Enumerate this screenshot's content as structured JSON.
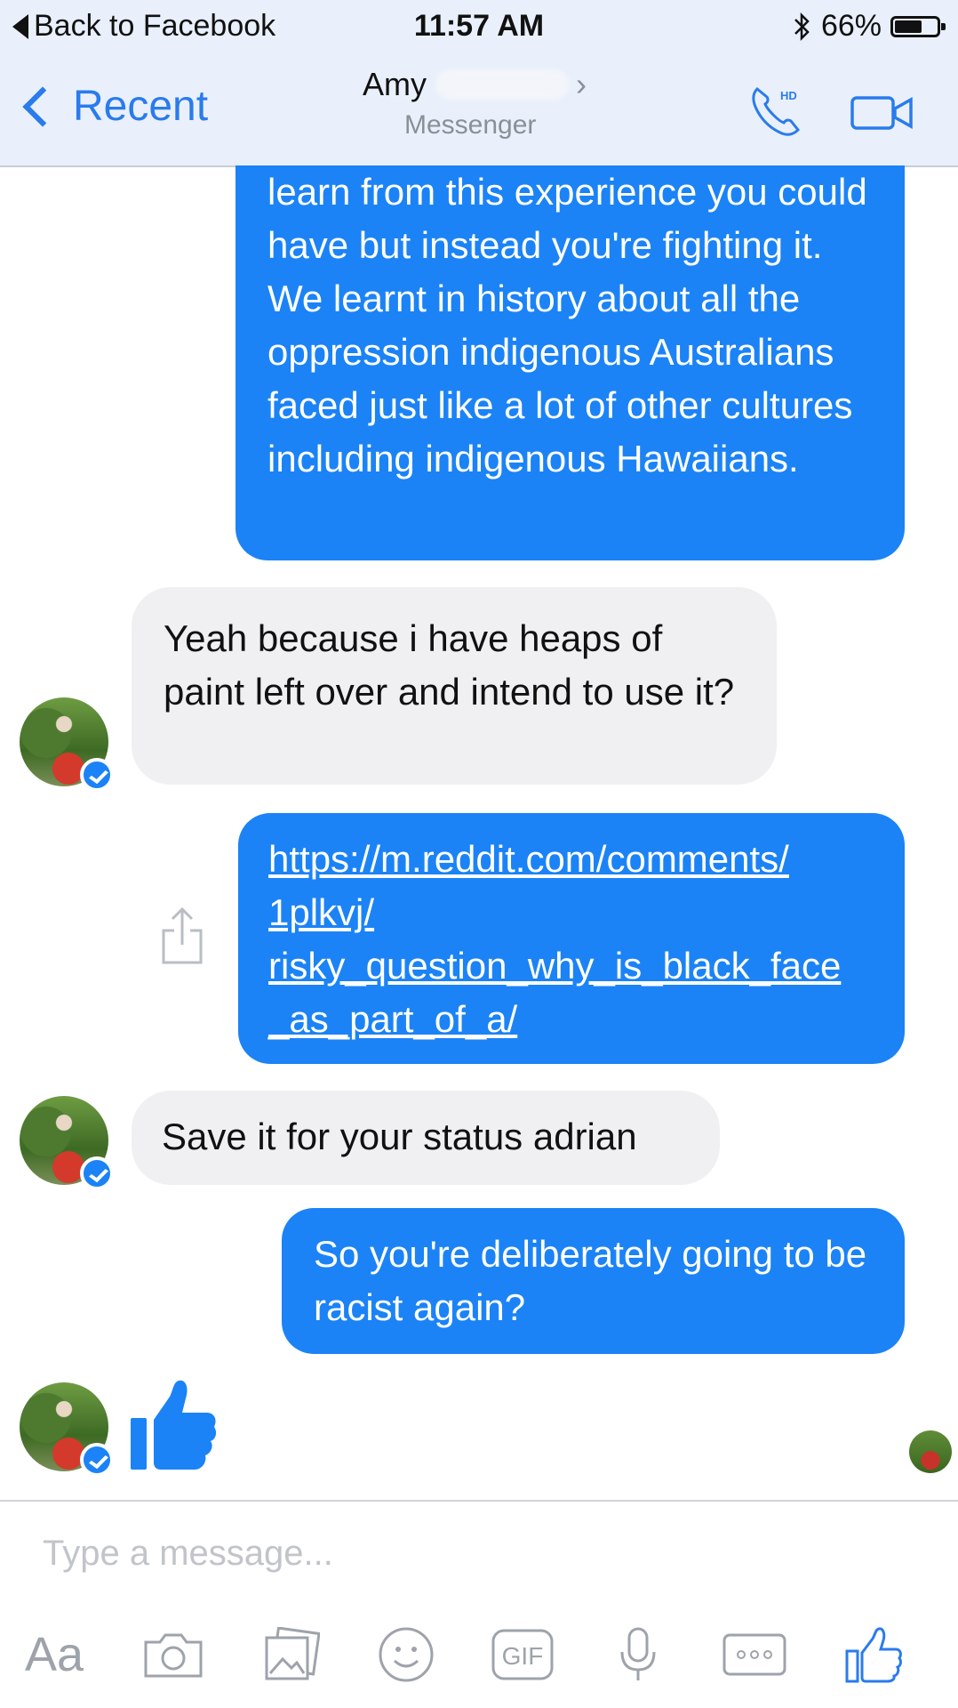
{
  "status_bar": {
    "back_label": "Back to Facebook",
    "time": "11:57 AM",
    "battery": "66%",
    "battery_level": 0.66,
    "icons": [
      "bluetooth-icon",
      "battery-icon"
    ]
  },
  "nav": {
    "back_label": "Recent",
    "contact_name": "Amy",
    "subtitle": "Messenger",
    "call_badge": "HD",
    "accent": "#2a7bec"
  },
  "messages": [
    {
      "from": "me",
      "text": "learn from this experience you could have but instead you're fighting it. We learnt in history about all the oppression indigenous Australians faced just like a lot of other cultures including indigenous Hawaiians."
    },
    {
      "from": "them",
      "text": "Yeah because i have heaps of paint left over and intend to use it?"
    },
    {
      "from": "me",
      "link": "https://m.reddit.com/comments/1plkvj/risky_question_why_is_black_face_as_part_of_a/",
      "link_lines": [
        "https://m.reddit.com/comments/",
        "1plkvj/",
        "risky_question_why_is_black_face",
        "_as_part_of_a/"
      ]
    },
    {
      "from": "them",
      "text": "Save it for your status adrian"
    },
    {
      "from": "me",
      "text": "So you're deliberately going to be racist again?"
    },
    {
      "from": "them",
      "sticker": "thumbs-up-icon"
    }
  ],
  "composer": {
    "placeholder": "Type a message...",
    "aa_label": "Aa",
    "gif_label": "GIF",
    "tools": [
      "camera-icon",
      "photo-icon",
      "emoji-icon",
      "gif-icon",
      "microphone-icon",
      "more-icon",
      "like-icon"
    ]
  },
  "colors": {
    "outgoing_bubble": "#1b83f6",
    "incoming_bubble": "#f0f0f3",
    "header_bg": "#e9f0fb",
    "tool_gray": "#9ea3ab"
  }
}
